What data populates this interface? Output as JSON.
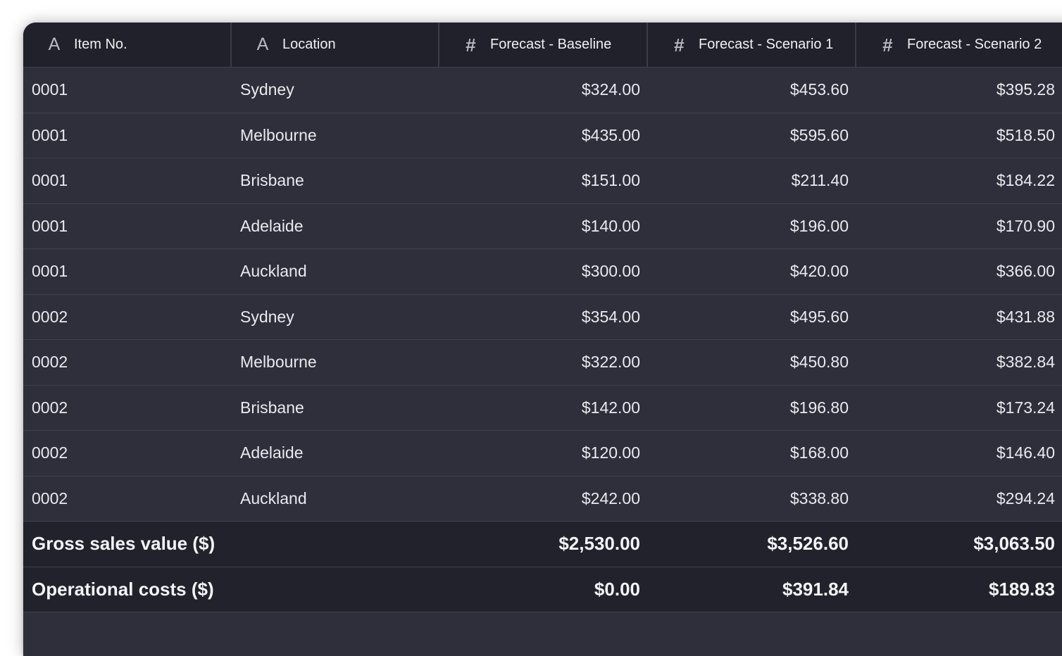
{
  "table": {
    "columns": [
      {
        "label": "Item No.",
        "type_icon": "text-type-icon"
      },
      {
        "label": "Location",
        "type_icon": "text-type-icon"
      },
      {
        "label": "Forecast - Baseline",
        "type_icon": "number-type-icon"
      },
      {
        "label": "Forecast - Scenario 1",
        "type_icon": "number-type-icon"
      },
      {
        "label": "Forecast - Scenario 2",
        "type_icon": "number-type-icon"
      }
    ],
    "icons": {
      "text": "A",
      "number": "#"
    },
    "rows": [
      {
        "item": "0001",
        "location": "Sydney",
        "baseline": "$324.00",
        "s1": "$453.60",
        "s2": "$395.28"
      },
      {
        "item": "0001",
        "location": "Melbourne",
        "baseline": "$435.00",
        "s1": "$595.60",
        "s2": "$518.50"
      },
      {
        "item": "0001",
        "location": "Brisbane",
        "baseline": "$151.00",
        "s1": "$211.40",
        "s2": "$184.22"
      },
      {
        "item": "0001",
        "location": "Adelaide",
        "baseline": "$140.00",
        "s1": "$196.00",
        "s2": "$170.90"
      },
      {
        "item": "0001",
        "location": "Auckland",
        "baseline": "$300.00",
        "s1": "$420.00",
        "s2": "$366.00"
      },
      {
        "item": "0002",
        "location": "Sydney",
        "baseline": "$354.00",
        "s1": "$495.60",
        "s2": "$431.88"
      },
      {
        "item": "0002",
        "location": "Melbourne",
        "baseline": "$322.00",
        "s1": "$450.80",
        "s2": "$382.84"
      },
      {
        "item": "0002",
        "location": "Brisbane",
        "baseline": "$142.00",
        "s1": "$196.80",
        "s2": "$173.24"
      },
      {
        "item": "0002",
        "location": "Adelaide",
        "baseline": "$120.00",
        "s1": "$168.00",
        "s2": "$146.40"
      },
      {
        "item": "0002",
        "location": "Auckland",
        "baseline": "$242.00",
        "s1": "$338.80",
        "s2": "$294.24"
      }
    ],
    "summary": [
      {
        "label": "Gross sales value ($)",
        "baseline": "$2,530.00",
        "s1": "$3,526.60",
        "s2": "$3,063.50"
      },
      {
        "label": "Operational costs ($)",
        "baseline": "$0.00",
        "s1": "$391.84",
        "s2": "$189.83"
      }
    ]
  },
  "colors": {
    "header_bg": "#20212a",
    "row_bg": "#2e2f3a",
    "summary_bg": "#21222b",
    "text": "#e9e9ee",
    "icon": "#b8b9c2",
    "divider": "#40414d"
  }
}
